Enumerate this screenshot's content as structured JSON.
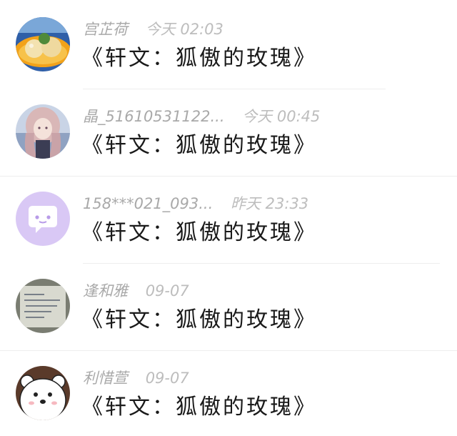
{
  "messages": [
    {
      "avatar_icon": "food-avatar-icon",
      "name": "宫芷荷",
      "time": "今天 02:03",
      "text": "《轩文：狐傲的玫瑰》"
    },
    {
      "avatar_icon": "anime-girl-avatar-icon",
      "name": "晶_51610531122...",
      "time": "今天 00:45",
      "text": "《轩文：狐傲的玫瑰》"
    },
    {
      "avatar_icon": "chat-bubble-avatar-icon",
      "name": "158***021_093...",
      "time": "昨天 23:33",
      "text": "《轩文：狐傲的玫瑰》"
    },
    {
      "avatar_icon": "handwriting-paper-avatar-icon",
      "name": "逢和雅",
      "time": "09-07",
      "text": "《轩文：狐傲的玫瑰》"
    },
    {
      "avatar_icon": "polar-bear-avatar-icon",
      "name": "利惜萱",
      "time": "09-07",
      "text": "《轩文：狐傲的玫瑰》"
    }
  ],
  "colors": {
    "name_text": "#a9a9a9",
    "time_text": "#bdbdbd",
    "content_text": "#1a1a1a",
    "chat_avatar_bg": "#d9c8f5",
    "divider": "#eeeeee"
  }
}
